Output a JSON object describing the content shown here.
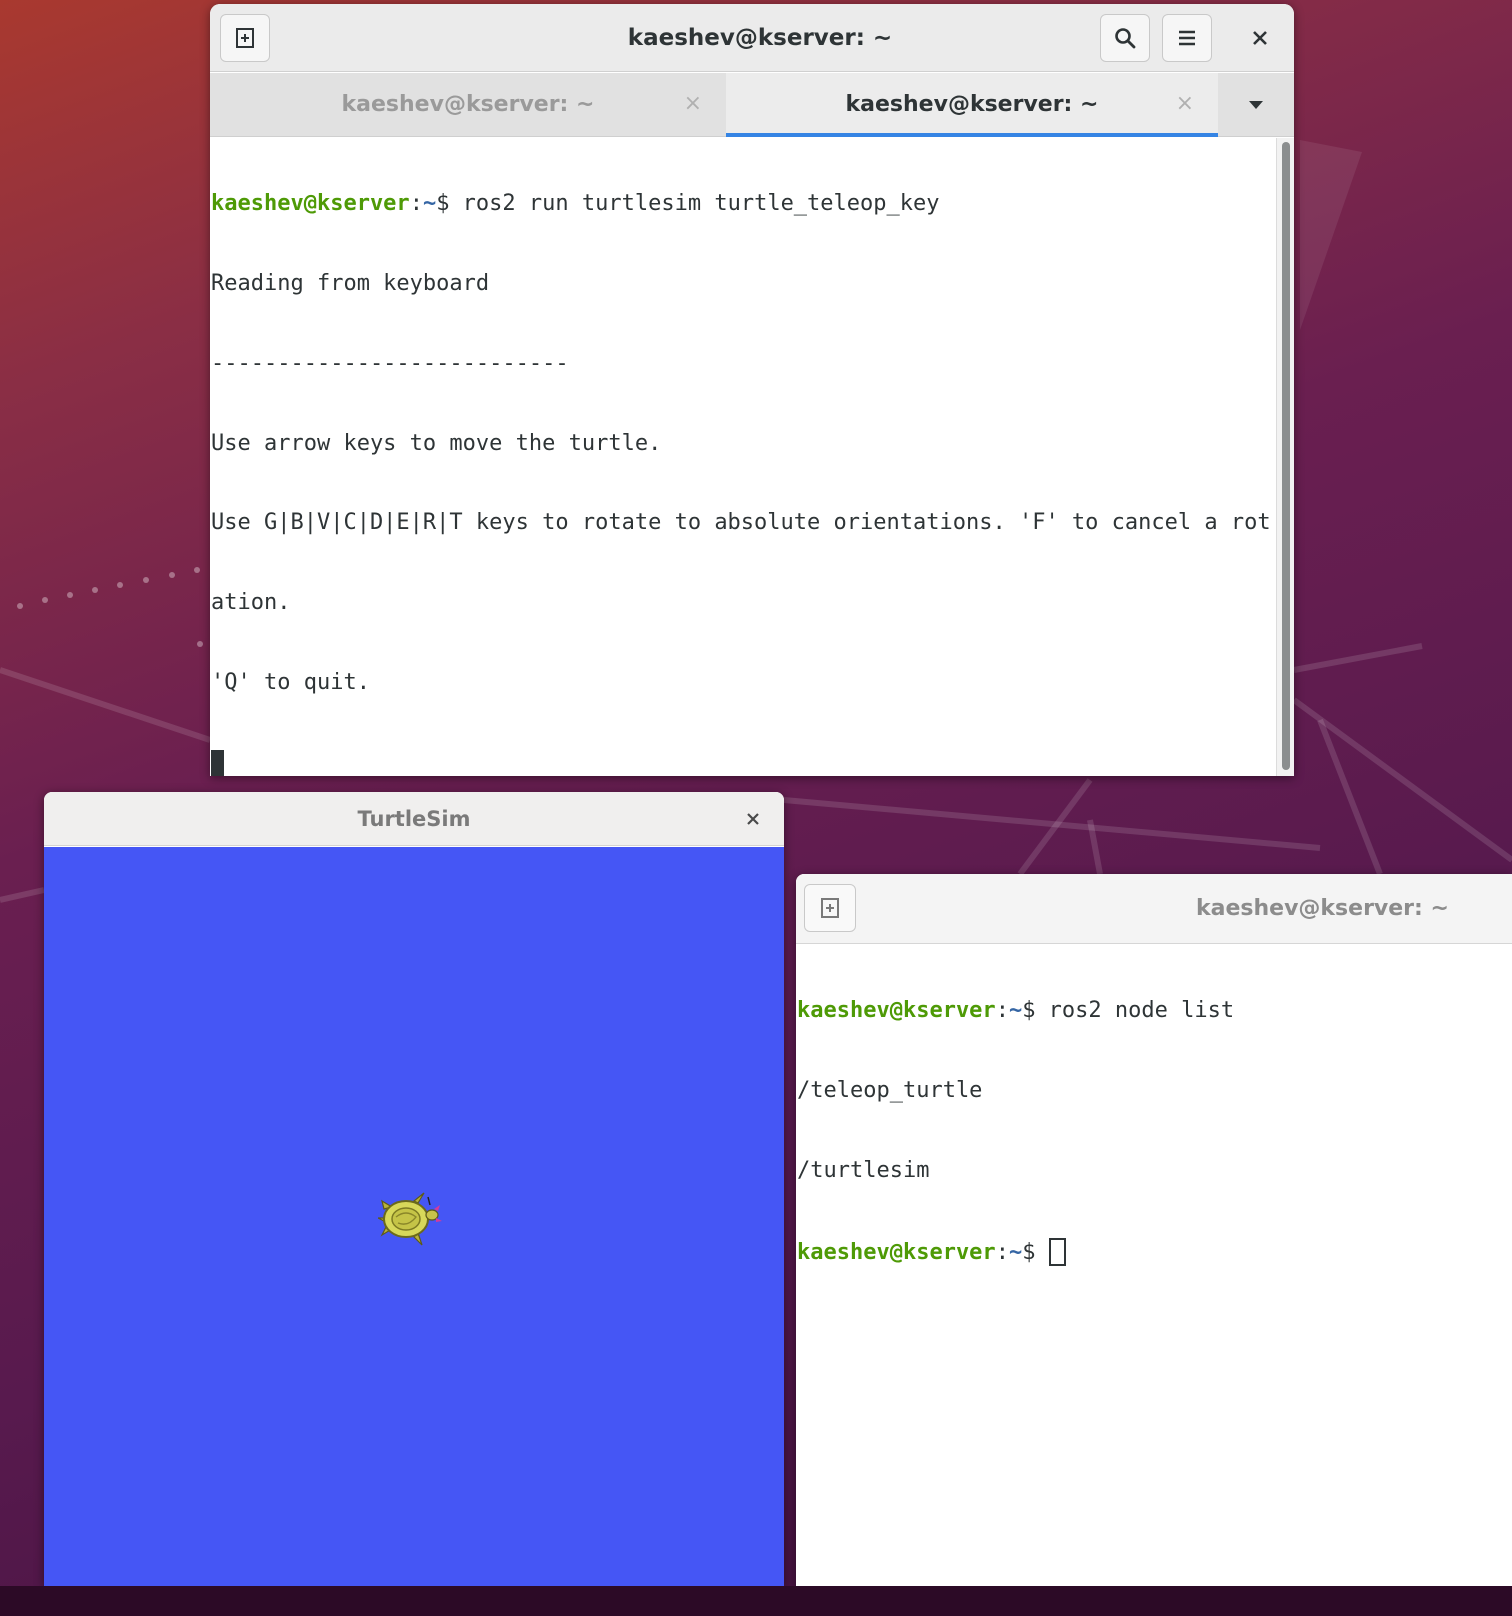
{
  "desktop": {
    "wallpaper": "ubuntu-focal-purple"
  },
  "terminal_main": {
    "new_tab_icon": "new-tab-icon",
    "title": "kaeshev@kserver: ~",
    "search_icon": "search-icon",
    "menu_icon": "hamburger-menu-icon",
    "close_icon": "close-icon",
    "tabs": [
      {
        "label": "kaeshev@kserver: ~",
        "close": "×",
        "active": false
      },
      {
        "label": "kaeshev@kserver: ~",
        "close": "×",
        "active": true
      }
    ],
    "tab_menu_icon": "chevron-down-icon",
    "prompt_user": "kaeshev@kserver",
    "prompt_sep": ":",
    "prompt_path": "~",
    "prompt_symbol": "$",
    "command": " ros2 run turtlesim turtle_teleop_key",
    "output": [
      "Reading from keyboard",
      "---------------------------",
      "Use arrow keys to move the turtle.",
      "Use G|B|V|C|D|E|R|T keys to rotate to absolute orientations. 'F' to cancel a rot",
      "ation.",
      "'Q' to quit."
    ]
  },
  "turtlesim": {
    "title": "TurtleSim",
    "close": "×",
    "background_color": "#4556f5"
  },
  "terminal_secondary": {
    "new_tab_icon": "new-tab-icon",
    "title": "kaeshev@kserver: ~",
    "prompt_user": "kaeshev@kserver",
    "prompt_sep": ":",
    "prompt_path": "~",
    "prompt_symbol": "$",
    "command": " ros2 node list",
    "output": [
      "/teleop_turtle",
      "/turtlesim"
    ]
  },
  "colors": {
    "prompt_user": "#4e9a06",
    "prompt_path": "#3465a4",
    "tab_active_underline": "#3584e4"
  }
}
